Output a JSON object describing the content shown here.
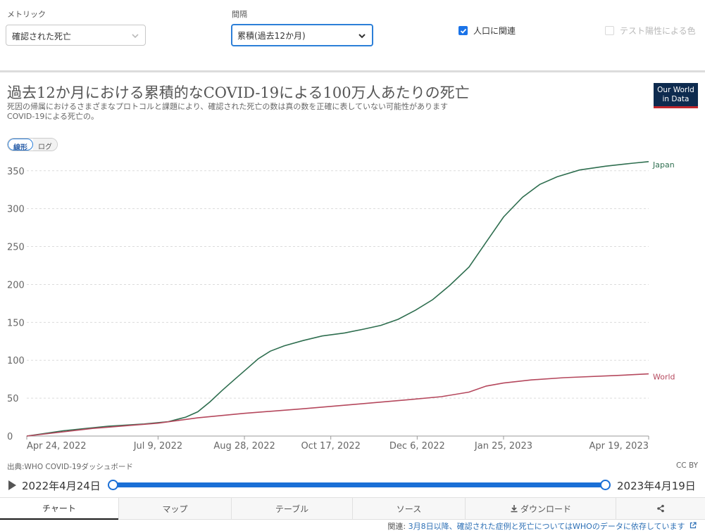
{
  "controls": {
    "metric_label": "メトリック",
    "metric_value": "確認された死亡",
    "interval_label": "間隔",
    "interval_value": "累積(過去12か月)",
    "per_capita_label": "人口に関連",
    "per_capita_checked": true,
    "positivity_label": "テスト陽性による色",
    "positivity_checked": false
  },
  "header": {
    "title": "過去12か月における累積的なCOVID-19による100万人あたりの死亡",
    "subtitle_line1": "死因の帰属におけるさまざまなプロトコルと課題により、確認された死亡の数は真の数を正確に表していない可能性があります",
    "subtitle_line2": "COVID-19による死亡の。",
    "logo_line1": "Our World",
    "logo_line2": "in Data",
    "scale_linear": "線形",
    "scale_log": "ログ"
  },
  "chart_data": {
    "type": "line",
    "x_tick_labels": [
      "Apr 24, 2022",
      "Jul 9, 2022",
      "Aug 28, 2022",
      "Oct 17, 2022",
      "Dec 6, 2022",
      "Jan 25, 2023",
      "Apr 19, 2023"
    ],
    "x_ticks": [
      "2022-04-24",
      "2022-07-09",
      "2022-08-28",
      "2022-10-17",
      "2022-12-06",
      "2023-01-25",
      "2023-04-19"
    ],
    "xlim": [
      "2022-04-24",
      "2023-04-19"
    ],
    "ylim": [
      0,
      360
    ],
    "y_ticks": [
      0,
      50,
      100,
      150,
      200,
      250,
      300,
      350
    ],
    "grid": "horizontal dashed",
    "legend": "inline labels at line ends",
    "series": [
      {
        "name": "Japan",
        "color": "#2e6e4f",
        "points": [
          [
            "2022-04-24",
            0
          ],
          [
            "2022-05-15",
            7
          ],
          [
            "2022-06-10",
            13
          ],
          [
            "2022-07-01",
            16
          ],
          [
            "2022-07-15",
            19
          ],
          [
            "2022-07-25",
            25
          ],
          [
            "2022-08-01",
            32
          ],
          [
            "2022-08-08",
            45
          ],
          [
            "2022-08-15",
            60
          ],
          [
            "2022-08-22",
            74
          ],
          [
            "2022-08-29",
            88
          ],
          [
            "2022-09-05",
            102
          ],
          [
            "2022-09-12",
            112
          ],
          [
            "2022-09-20",
            119
          ],
          [
            "2022-10-01",
            126
          ],
          [
            "2022-10-12",
            132
          ],
          [
            "2022-10-25",
            136
          ],
          [
            "2022-11-05",
            141
          ],
          [
            "2022-11-15",
            146
          ],
          [
            "2022-11-25",
            154
          ],
          [
            "2022-12-05",
            166
          ],
          [
            "2022-12-15",
            180
          ],
          [
            "2022-12-25",
            199
          ],
          [
            "2023-01-05",
            223
          ],
          [
            "2023-01-15",
            256
          ],
          [
            "2023-01-25",
            289
          ],
          [
            "2023-02-05",
            315
          ],
          [
            "2023-02-15",
            332
          ],
          [
            "2023-02-25",
            342
          ],
          [
            "2023-03-10",
            351
          ],
          [
            "2023-03-25",
            356
          ],
          [
            "2023-04-10",
            360
          ],
          [
            "2023-04-19",
            362
          ]
        ]
      },
      {
        "name": "World",
        "color": "#b5485d",
        "points": [
          [
            "2022-04-24",
            0
          ],
          [
            "2022-06-01",
            10
          ],
          [
            "2022-07-09",
            17
          ],
          [
            "2022-08-01",
            24
          ],
          [
            "2022-08-28",
            30
          ],
          [
            "2022-10-01",
            36
          ],
          [
            "2022-11-01",
            42
          ],
          [
            "2022-12-01",
            48
          ],
          [
            "2022-12-20",
            52
          ],
          [
            "2023-01-05",
            58
          ],
          [
            "2023-01-15",
            66
          ],
          [
            "2023-01-25",
            70
          ],
          [
            "2023-02-10",
            74
          ],
          [
            "2023-03-01",
            77
          ],
          [
            "2023-04-01",
            80
          ],
          [
            "2023-04-19",
            82
          ]
        ]
      }
    ]
  },
  "footer": {
    "source": "出典:WHO COVID-19ダッシュボード",
    "license": "CC BY",
    "date_start": "2022年4月24日",
    "date_end": "2023年4月19日",
    "related_prefix": "関連: ",
    "related_link": "3月8日以降、確認された症例と死亡についてはWHOのデータに依存しています"
  },
  "tabs": [
    {
      "label": "チャート",
      "active": true
    },
    {
      "label": "マップ",
      "active": false
    },
    {
      "label": "テーブル",
      "active": false
    },
    {
      "label": "ソース",
      "active": false
    },
    {
      "label": "ダウンロード",
      "active": false
    },
    {
      "label": "",
      "active": false
    }
  ]
}
